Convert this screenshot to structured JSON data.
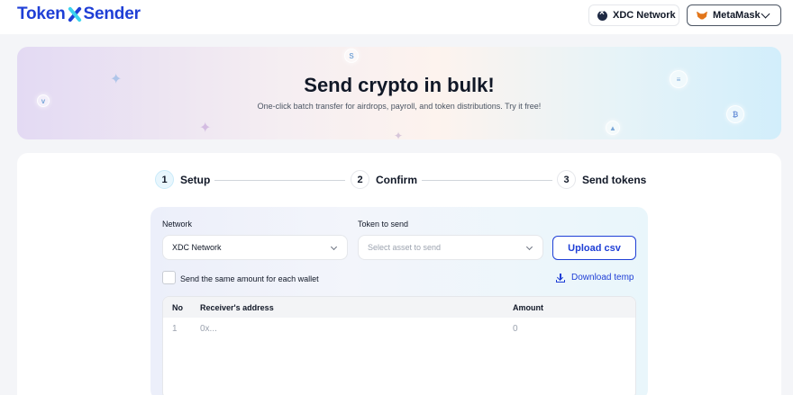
{
  "header": {
    "logo_left": "Token",
    "logo_right": "Sender",
    "network_label": "XDC Network",
    "wallet_label": "MetaMask"
  },
  "hero": {
    "title": "Send crypto in bulk!",
    "subtitle": "One-click batch transfer for airdrops, payroll, and token distributions. Try it free!"
  },
  "steps": [
    {
      "num": "1",
      "label": "Setup",
      "active": true
    },
    {
      "num": "2",
      "label": "Confirm",
      "active": false
    },
    {
      "num": "3",
      "label": "Send tokens",
      "active": false
    }
  ],
  "form": {
    "network_label": "Network",
    "network_value": "XDC Network",
    "token_label": "Token to send",
    "token_placeholder": "Select asset to send",
    "upload_label": "Upload csv",
    "same_amount_label": "Send the same amount for each wallet",
    "same_amount_checked": false,
    "download_label": "Download temp"
  },
  "table": {
    "columns": [
      "No",
      "Receiver's address",
      "Amount"
    ],
    "rows": [
      {
        "no": "1",
        "address": "0x...",
        "amount": "0"
      }
    ]
  },
  "colors": {
    "brand": "#1f3fd6",
    "accent": "#3dd3ee"
  }
}
